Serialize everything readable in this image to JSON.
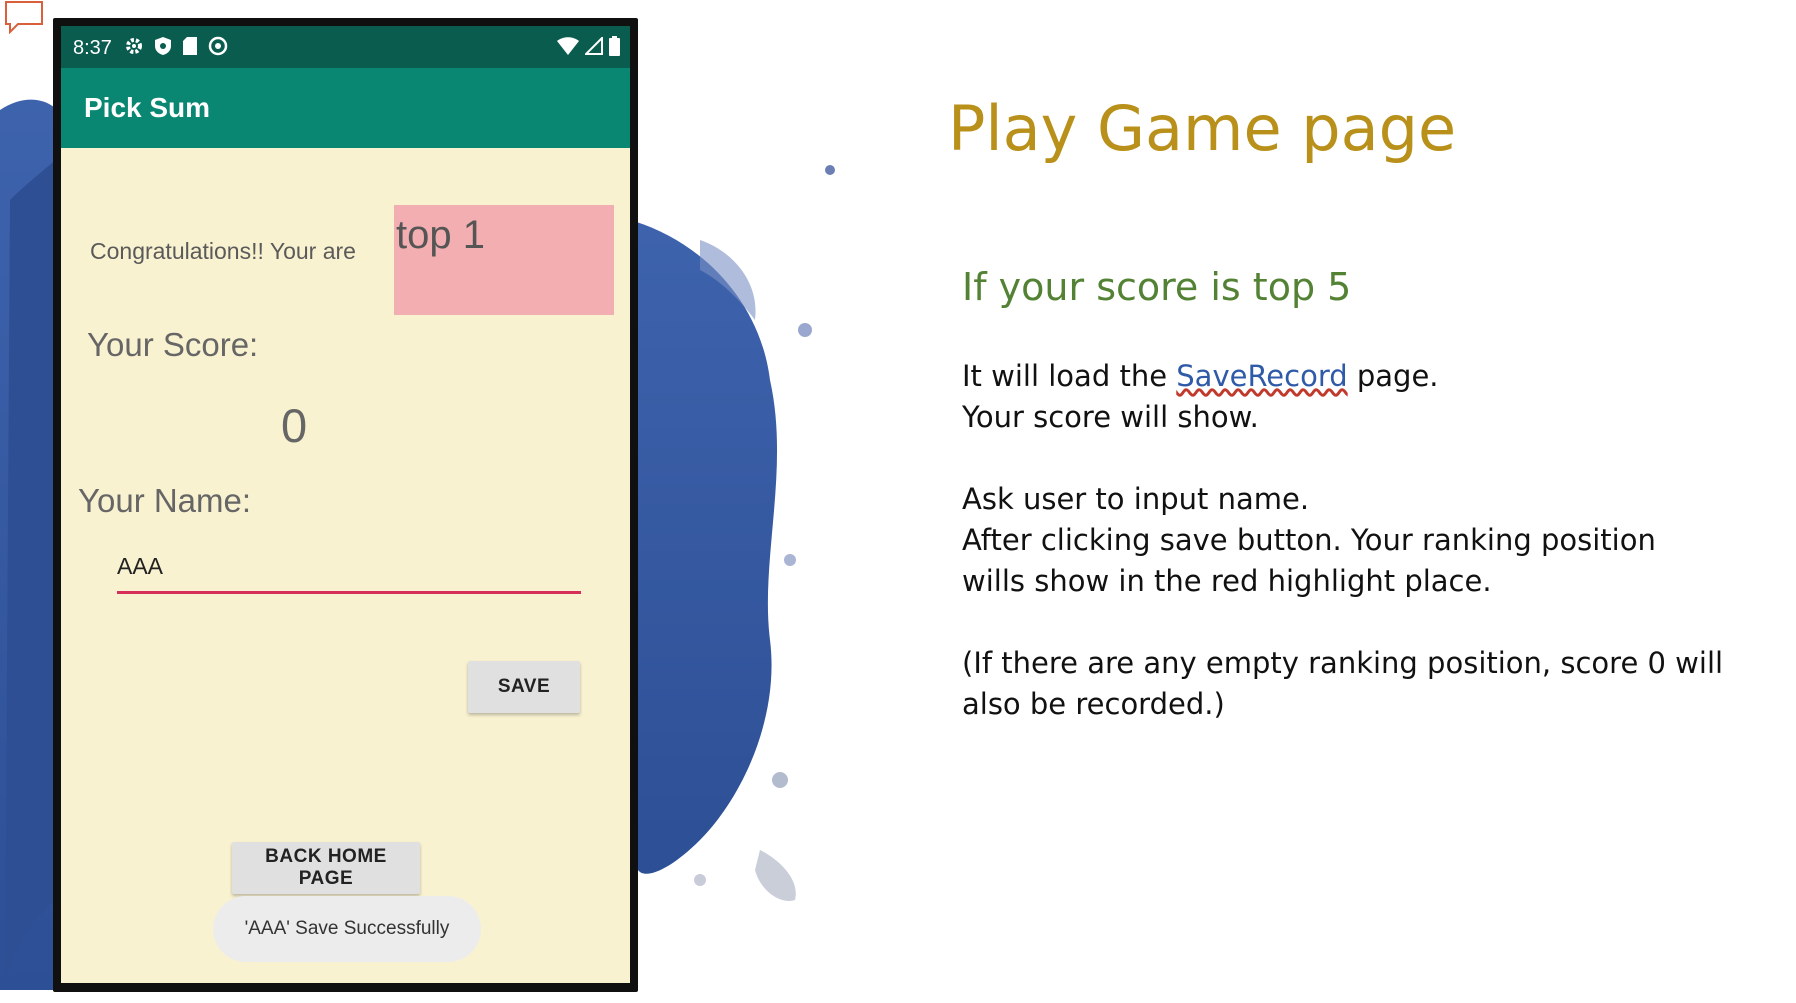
{
  "phone": {
    "status_bar": {
      "time": "8:37"
    },
    "app_bar": {
      "title": "Pick Sum"
    },
    "congrats_text": "Congratulations!! Your are",
    "rank_text": "top 1",
    "score_label": "Your Score:",
    "score_value": "0",
    "name_label": "Your Name:",
    "name_value": "AAA",
    "save_button": "SAVE",
    "back_button": "BACK HOME PAGE",
    "toast": "'AAA' Save Successfully"
  },
  "slide": {
    "title": "Play Game page",
    "subheading": "If your score is top 5",
    "para1_line1_a": "It will load the ",
    "para1_link": "SaveRecord",
    "para1_line1_b": " page.",
    "para1_line2": "Your score will show.",
    "para2_line1": "Ask user  to input name.",
    "para2_line2": "After clicking save button. Your ranking position",
    "para2_line3": "wills show in the red highlight place.",
    "para3_line1": "(If there are any empty ranking position, score 0 will",
    "para3_line2": "also be recorded.)"
  },
  "colors": {
    "app_bar": "#0a8773",
    "status_bar": "#0a5c4f",
    "screen_bg": "#f9f2d0",
    "highlight": "#f2aeb0",
    "title": "#b8901a",
    "subheading": "#548235",
    "input_underline": "#d6305a"
  }
}
